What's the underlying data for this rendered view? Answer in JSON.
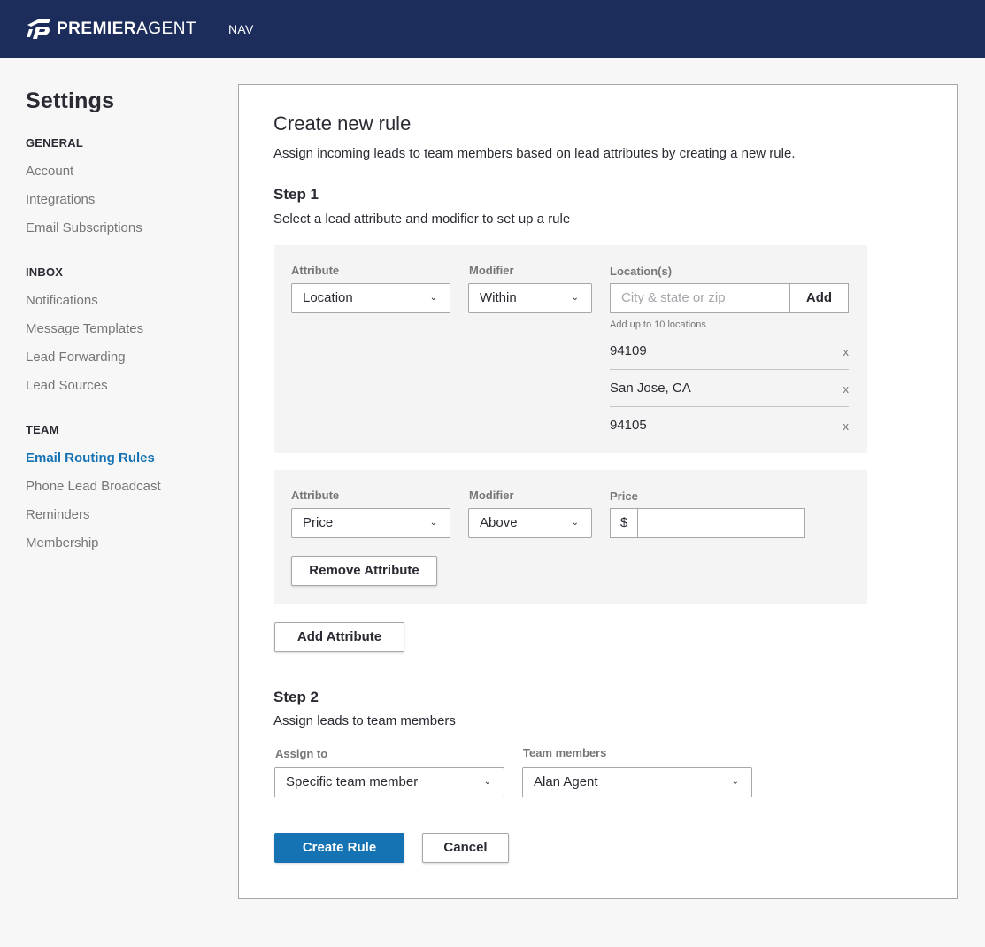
{
  "header": {
    "logo_bold": "PREMIER",
    "logo_light": "AGENT",
    "nav_label": "NAV"
  },
  "sidebar": {
    "title": "Settings",
    "groups": [
      {
        "title": "GENERAL",
        "items": [
          "Account",
          "Integrations",
          "Email Subscriptions"
        ]
      },
      {
        "title": "INBOX",
        "items": [
          "Notifications",
          "Message Templates",
          "Lead Forwarding",
          "Lead Sources"
        ]
      },
      {
        "title": "TEAM",
        "items": [
          "Email Routing Rules",
          "Phone Lead Broadcast",
          "Reminders",
          "Membership"
        ]
      }
    ],
    "active_item": "Email Routing Rules"
  },
  "form": {
    "title": "Create new rule",
    "subtitle": "Assign incoming leads to team members based on lead attributes by creating a new rule.",
    "step1": {
      "title": "Step 1",
      "description": "Select a lead attribute and modifier to set up a rule"
    },
    "rule1": {
      "attribute_label": "Attribute",
      "attribute_value": "Location",
      "modifier_label": "Modifier",
      "modifier_value": "Within",
      "locations_label": "Location(s)",
      "location_placeholder": "City & state or zip",
      "add_label": "Add",
      "hint": "Add up to 10 locations",
      "locations": [
        "94109",
        "San Jose, CA",
        "94105"
      ],
      "remove_glyph": "x"
    },
    "rule2": {
      "attribute_label": "Attribute",
      "attribute_value": "Price",
      "modifier_label": "Modifier",
      "modifier_value": "Above",
      "price_label": "Price",
      "currency_symbol": "$",
      "price_value": "",
      "remove_label": "Remove Attribute"
    },
    "add_attribute_label": "Add Attribute",
    "step2": {
      "title": "Step 2",
      "description": "Assign leads to team members",
      "assign_label": "Assign to",
      "assign_value": "Specific team member",
      "members_label": "Team members",
      "members_value": "Alan Agent"
    },
    "create_label": "Create Rule",
    "cancel_label": "Cancel"
  },
  "colors": {
    "header_bg": "#1d2d5b",
    "accent": "#1673b3",
    "box_bg": "#f4f4f4"
  },
  "icons": {
    "chevron": "chevron-down-icon",
    "logo": "premier-agent-logo-icon"
  }
}
